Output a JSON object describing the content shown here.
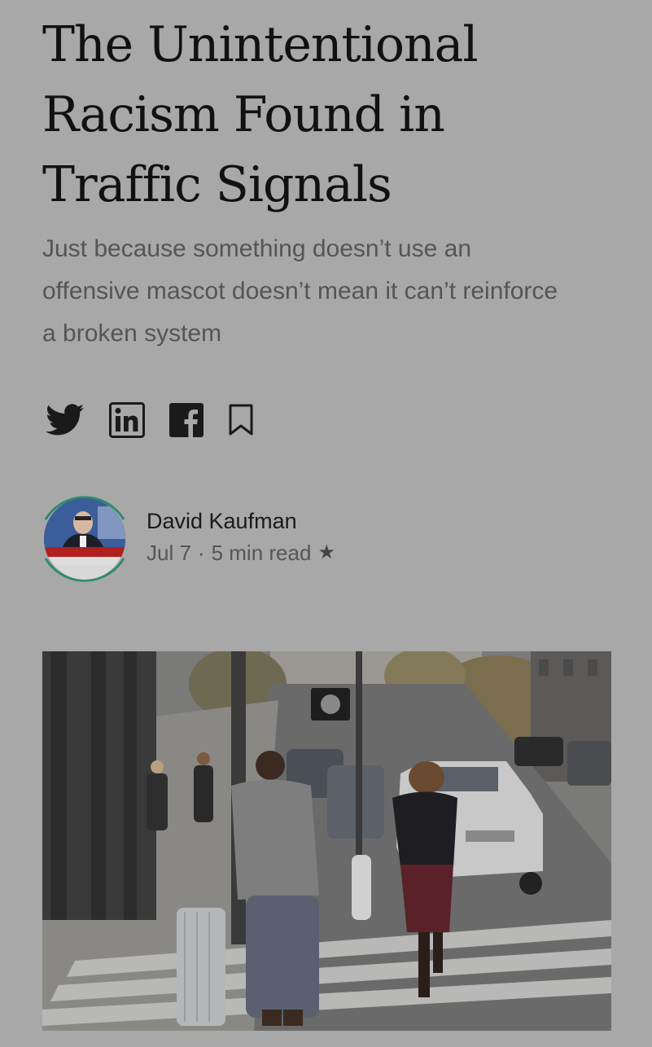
{
  "article": {
    "title": "The Unintentional Racism Found in Traffic Signals",
    "subtitle": "Just because something doesn’t use an offensive mascot doesn’t mean it can’t reinforce a broken system"
  },
  "share": {
    "icons": [
      "twitter-icon",
      "linkedin-icon",
      "facebook-icon",
      "bookmark-icon"
    ]
  },
  "author": {
    "name": "David Kaufman",
    "date": "Jul 7",
    "separator": "·",
    "read_time": "5 min read",
    "member_star": "★",
    "ring_color": "#2e8b6e"
  },
  "hero_image": {
    "subject": "pedestrians crossing a city street with a traffic signal"
  },
  "colors": {
    "background": "#a8a8a8",
    "title": "#111111",
    "subtitle": "#555555"
  }
}
